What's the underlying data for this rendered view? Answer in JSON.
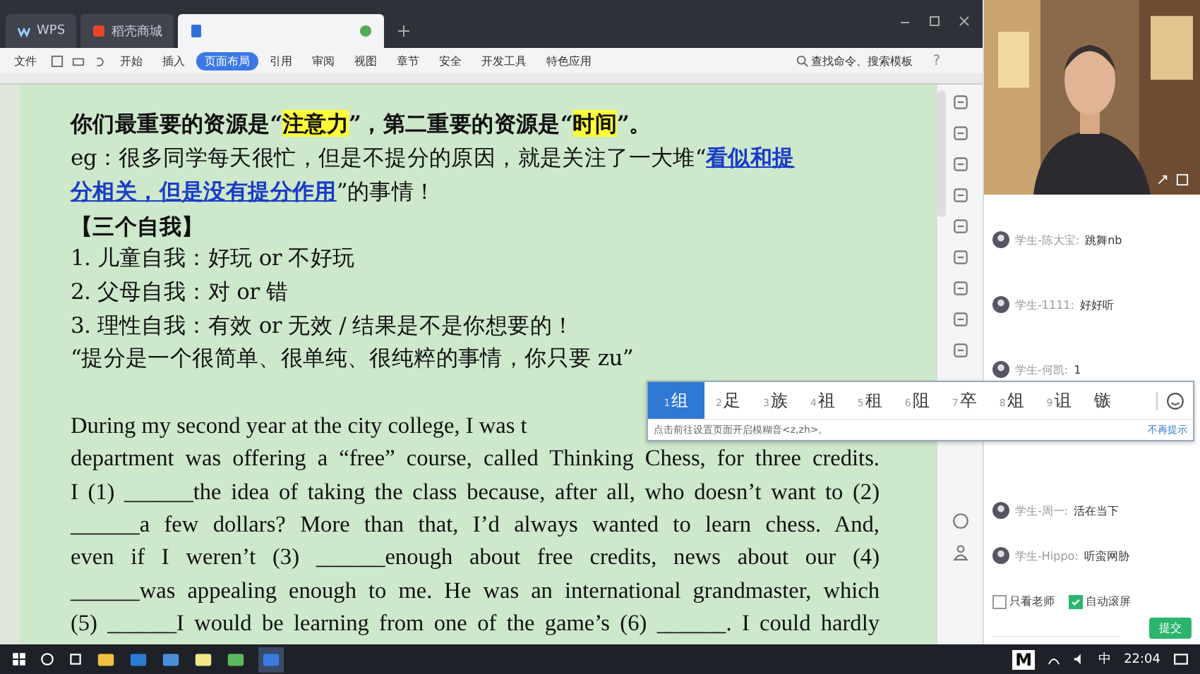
{
  "tabs": [
    {
      "label": "WPS",
      "kind": "home",
      "selected": false
    },
    {
      "label": "稻壳商城",
      "kind": "store",
      "selected": false
    },
    {
      "kind": "document",
      "selected": true
    }
  ],
  "ribbon": {
    "file_menu": "文件",
    "tabs": [
      {
        "label": "开始",
        "selected": false
      },
      {
        "label": "插入",
        "selected": false
      },
      {
        "label": "页面布局",
        "selected": true
      },
      {
        "label": "引用",
        "selected": false
      },
      {
        "label": "审阅",
        "selected": false
      },
      {
        "label": "视图",
        "selected": false
      },
      {
        "label": "章节",
        "selected": false
      },
      {
        "label": "安全",
        "selected": false
      },
      {
        "label": "开发工具",
        "selected": false
      },
      {
        "label": "特色应用",
        "selected": false
      }
    ],
    "search": {
      "placeholder": "查找命令、搜索模板"
    },
    "help": "?"
  },
  "document": {
    "lines": [
      {
        "bold": true,
        "segments": [
          {
            "text": "你们最重要的资源是“",
            "kind": "plain"
          },
          {
            "text": "注意力",
            "kind": "highlight"
          },
          {
            "text": "”，第二重要的资源是“",
            "kind": "plain"
          },
          {
            "text": "时间",
            "kind": "highlight"
          },
          {
            "text": "”。",
            "kind": "plain"
          }
        ]
      },
      {
        "bold": false,
        "segments": [
          {
            "text": "eg：很多同学每天很忙，但是不提分的原因，就是关注了一大堆“",
            "kind": "plain"
          },
          {
            "text": "看似和提",
            "kind": "link"
          }
        ]
      },
      {
        "bold": false,
        "segments": [
          {
            "text": "分相关，但是没有提分作用",
            "kind": "link"
          },
          {
            "text": "”的事情！",
            "kind": "plain"
          }
        ]
      },
      {
        "bold": true,
        "segments": [
          {
            "text": "【三个自我】",
            "kind": "plain"
          }
        ]
      },
      {
        "bold": false,
        "segments": [
          {
            "text": "1.  儿童自我：好玩 or 不好玩",
            "kind": "plain"
          }
        ]
      },
      {
        "bold": false,
        "segments": [
          {
            "text": "2.  父母自我：对 or 错",
            "kind": "plain"
          }
        ]
      },
      {
        "bold": false,
        "segments": [
          {
            "text": "3.  理性自我：有效 or 无效 / 结果是不是你想要的！",
            "kind": "plain"
          }
        ]
      },
      {
        "bold": false,
        "segments": [
          {
            "text": "“提分是一个很简单、很单纯、很纯粹的事情，你只要 zu”",
            "kind": "plain"
          }
        ]
      }
    ],
    "english_lines": [
      {
        "text": "During my second year at the city college, I was t",
        "justified": false
      },
      {
        "text": "department was offering a “free” course, called Thinking Chess, for three credits.",
        "justified": true
      },
      {
        "text": "I (1) ______the idea of taking the class because, after all, who doesn’t want to (2)",
        "justified": true
      },
      {
        "text": "______a few dollars? More than that, I’d always wanted to learn chess. And,",
        "justified": true
      },
      {
        "text": "even if I weren’t (3) ______enough about free credits, news about our (4)",
        "justified": true
      },
      {
        "text": "______was appealing enough to me. He was an international grandmaster, which",
        "justified": true
      },
      {
        "text": "(5) ______I would be learning from one of the game’s (6) ______. I could hardly",
        "justified": true
      }
    ]
  },
  "chat": {
    "messages": [
      {
        "sender": "学生-陈大宝:",
        "text": "跳舞nb"
      },
      {
        "sender": "学生-1111:",
        "text": "好好听"
      },
      {
        "sender": "学生-何凯:",
        "text": "1"
      },
      {
        "sender": "学生-周一:",
        "text": "活在当下"
      },
      {
        "sender": "学生-Hippo:",
        "text": "听蛮网胁"
      }
    ],
    "options": [
      {
        "label": "只看老师",
        "checked": false
      },
      {
        "label": "自动滚屏",
        "checked": true
      }
    ],
    "submit": "提交"
  },
  "ime": {
    "candidates": [
      {
        "label": "1",
        "text": "组",
        "selected": true
      },
      {
        "label": "2",
        "text": "足",
        "selected": false
      },
      {
        "label": "3",
        "text": "族",
        "selected": false
      },
      {
        "label": "4",
        "text": "祖",
        "selected": false
      },
      {
        "label": "5",
        "text": "租",
        "selected": false
      },
      {
        "label": "6",
        "text": "阻",
        "selected": false
      },
      {
        "label": "7",
        "text": "卒",
        "selected": false
      },
      {
        "label": "8",
        "text": "俎",
        "selected": false
      },
      {
        "label": "9",
        "text": "诅",
        "selected": false
      },
      {
        "text": "镞",
        "selected": false
      }
    ],
    "hint": "点击前往设置页面开启模糊音<z,zh>。",
    "dismiss": "不再提示"
  },
  "taskbar": {
    "pinned_letter": "M",
    "input_method": "中",
    "time": "22:04"
  }
}
